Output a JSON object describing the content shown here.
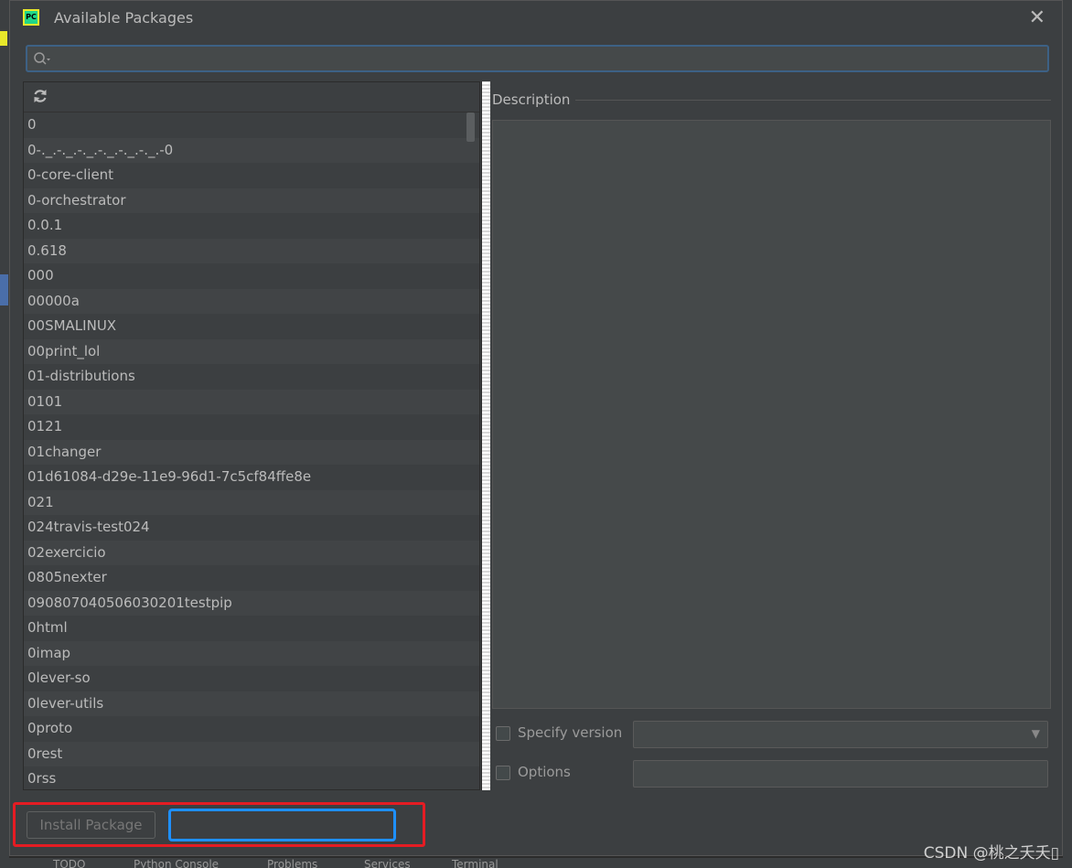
{
  "dialog": {
    "title": "Available Packages",
    "close_glyph": "✕",
    "app_logo_text": "PC"
  },
  "search": {
    "value": "",
    "placeholder": "",
    "icon": "search-icon"
  },
  "packages": [
    "0",
    "0-._.-._.-._.-._.-._.-._.-0",
    "0-core-client",
    "0-orchestrator",
    "0.0.1",
    "0.618",
    "000",
    "00000a",
    "00SMALINUX",
    "00print_lol",
    "01-distributions",
    "0101",
    "0121",
    "01changer",
    "01d61084-d29e-11e9-96d1-7c5cf84ffe8e",
    "021",
    "024travis-test024",
    "02exercicio",
    "0805nexter",
    "090807040506030201testpip",
    "0html",
    "0imap",
    "0lever-so",
    "0lever-utils",
    "0proto",
    "0rest",
    "0rss"
  ],
  "details": {
    "description_label": "Description",
    "specify_version_label": "Specify version",
    "options_label": "Options",
    "version_value": "",
    "options_value": ""
  },
  "footer": {
    "install_label": "Install Package"
  },
  "watermark": "CSDN @桃之夭夭▯",
  "background_ide": {
    "bottom_tabs": [
      "TODO",
      "Python Console",
      "Problems",
      "Services",
      "Terminal"
    ]
  },
  "colors": {
    "highlight_red": "#e51c23",
    "highlight_blue": "#1e90ff",
    "search_focus": "#3d6185"
  }
}
